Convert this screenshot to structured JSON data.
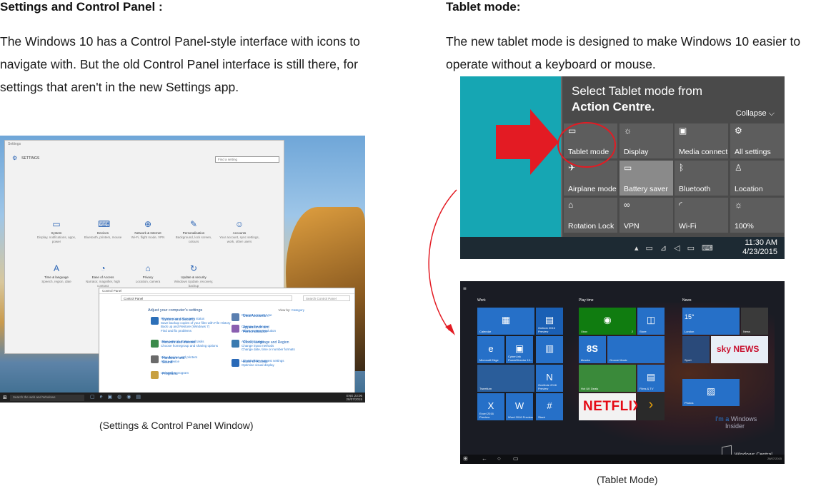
{
  "left": {
    "heading": "Settings and Control Panel :",
    "lines": [
      "The Windows 10 has a Control Panel-style interface with icons to",
      "navigate with. But the old Control Panel interface is still there, for",
      "settings that aren't in the new Settings app."
    ],
    "caption": "(Settings & Control Panel Window)"
  },
  "right": {
    "heading": "Tablet mode:",
    "lines": [
      "The new tablet mode is designed to make Windows 10 easier to",
      "operate without a keyboard or mouse."
    ],
    "caption": "(Tablet Mode)"
  },
  "settings_window": {
    "titlebar": "Settings",
    "header": "SETTINGS",
    "find_placeholder": "Find a setting",
    "items": [
      {
        "icon": "laptop-icon",
        "title": "System",
        "sub": "Display, notifications, apps, power"
      },
      {
        "icon": "devices-icon",
        "title": "Devices",
        "sub": "Bluetooth, printers, mouse"
      },
      {
        "icon": "globe-icon",
        "title": "Network & Internet",
        "sub": "Wi-Fi, flight mode, VPN"
      },
      {
        "icon": "paintbrush-icon",
        "title": "Personalisation",
        "sub": "Background, lock screen, colours"
      },
      {
        "icon": "person-icon",
        "title": "Accounts",
        "sub": "Your account, sync settings, work, other users"
      },
      {
        "icon": "language-icon",
        "title": "Time & language",
        "sub": "Speech, region, date"
      },
      {
        "icon": "ease-of-access-icon",
        "title": "Ease of Access",
        "sub": "Narrator, magnifier, high contrast"
      },
      {
        "icon": "lock-icon",
        "title": "Privacy",
        "sub": "Location, camera"
      },
      {
        "icon": "refresh-icon",
        "title": "Update & security",
        "sub": "Windows Update, recovery, backup"
      }
    ]
  },
  "control_panel": {
    "titlebar": "Control Panel",
    "address": "Control Panel",
    "search_placeholder": "Search Control Panel",
    "title": "Adjust your computer's settings",
    "view_by": "View by:",
    "view_value": "Category",
    "categories": [
      {
        "title": "System and Security",
        "links": [
          "Review your computer's status",
          "Save backup copies of your files with File History",
          "Back up and Restore (Windows 7)",
          "Find and fix problems"
        ],
        "color": "#2c6fb8"
      },
      {
        "title": "Network and Internet",
        "links": [
          "View network status and tasks",
          "Choose homegroup and sharing options"
        ],
        "color": "#3b8a4a"
      },
      {
        "title": "Hardware and Sound",
        "links": [
          "View devices and printers",
          "Add a device"
        ],
        "color": "#6a6a6a"
      },
      {
        "title": "Programs",
        "links": [
          "Uninstall a program"
        ],
        "color": "#c8a040"
      },
      {
        "title": "User Accounts",
        "links": [
          "Change account type"
        ],
        "color": "#5a7fb0"
      },
      {
        "title": "Appearance and Personalisation",
        "links": [
          "Change the theme",
          "Adjust screen resolution"
        ],
        "color": "#8a5fb0"
      },
      {
        "title": "Clock, Language and Region",
        "links": [
          "Add a language",
          "Change input methods",
          "Change date, time or number formats"
        ],
        "color": "#3a7ab0"
      },
      {
        "title": "Ease of Access",
        "links": [
          "Let Windows suggest settings",
          "Optimise visual display"
        ],
        "color": "#2a6ab8"
      }
    ]
  },
  "taskbar1": {
    "search": "Search the web and Windows",
    "lang": "ENG",
    "time": "23:06",
    "date": "28/07/2015"
  },
  "action_centre": {
    "title_line1": "Select Tablet mode from",
    "title_line2": "Action Centre.",
    "collapse": "Collapse",
    "tiles": [
      {
        "icon": "tablet-mode-icon",
        "label": "Tablet mode",
        "on": false
      },
      {
        "icon": "brightness-icon",
        "label": "Display",
        "on": false
      },
      {
        "icon": "media-connect-icon",
        "label": "Media connect",
        "on": false
      },
      {
        "icon": "gear-icon",
        "label": "All settings",
        "on": false
      },
      {
        "icon": "airplane-icon",
        "label": "Airplane mode",
        "on": false
      },
      {
        "icon": "battery-icon",
        "label": "Battery saver",
        "on": true
      },
      {
        "icon": "bluetooth-icon",
        "label": "Bluetooth",
        "on": false
      },
      {
        "icon": "location-icon",
        "label": "Location",
        "on": false
      },
      {
        "icon": "rotation-lock-icon",
        "label": "Rotation Lock",
        "on": false
      },
      {
        "icon": "vpn-icon",
        "label": "VPN",
        "on": false
      },
      {
        "icon": "wifi-icon",
        "label": "Wi-Fi",
        "on": false
      },
      {
        "icon": "brightness-icon",
        "label": "100%",
        "on": false
      }
    ],
    "time": "11:30 AM",
    "date": "4/23/2015"
  },
  "tablet_mode": {
    "groups": [
      "Work",
      "Play time",
      "News"
    ],
    "tiles": {
      "calendar": "Calendar",
      "outlook": "Outlook 2016 Preview",
      "edge": "Microsoft Edge",
      "cyberlink": "CyberLink PowerDirector 13...",
      "tweetium": "Tweetium",
      "onenote": "OneNote 2016 Preview",
      "excel": "Excel 2016 Preview",
      "word": "Word 2016 Preview",
      "slack": "Slack",
      "xbox": "Xbox",
      "xbox_badge": "2",
      "store": "Store",
      "sixtrack": "8tracks",
      "groove": "Groove Music",
      "hotuk": "Hot UK Deals",
      "films": "Films & TV",
      "netflix": "NETFLIX",
      "london": "London",
      "news": "News",
      "sport": "Sport",
      "sky": "sky NEWS",
      "photos": "Photos",
      "weather_temp": "15°",
      "insider_1": "I'm a",
      "insider_2": "Windows",
      "insider_3": "Insider",
      "watermark": "Windows Central",
      "wm_date": "28/07/2015"
    }
  }
}
